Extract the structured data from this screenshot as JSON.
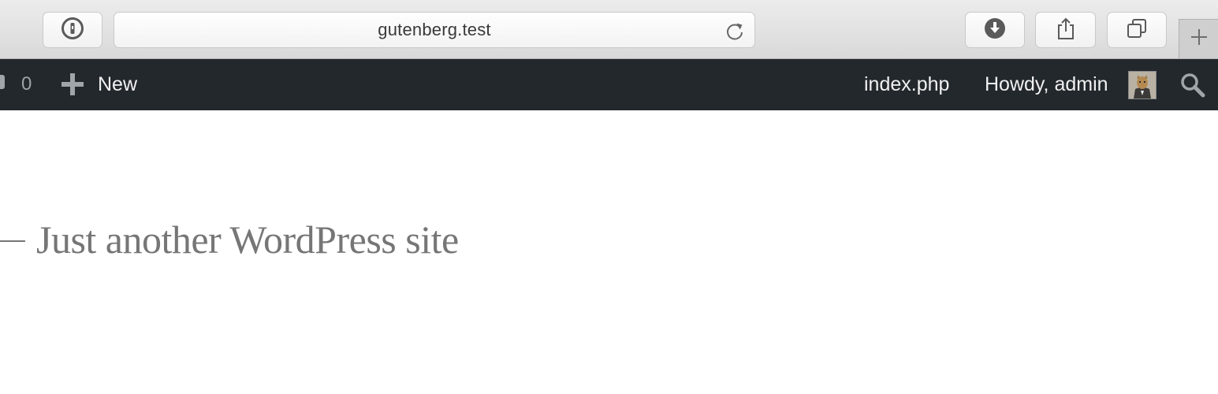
{
  "browser": {
    "address": "gutenberg.test",
    "icons": {
      "password_manager": "1password-icon",
      "reload": "reload-icon",
      "download": "download-icon",
      "share": "share-icon",
      "tabs": "tab-overview-icon",
      "new_tab": "plus-icon"
    }
  },
  "adminbar": {
    "comments_count": "0",
    "new_label": "New",
    "page_link": "index.php",
    "greeting": "Howdy, admin",
    "icons": {
      "new": "plus-icon",
      "search": "search-icon",
      "avatar": "avatar"
    }
  },
  "content": {
    "tagline": "Just another WordPress site"
  },
  "colors": {
    "adminbar_bg": "#23282d",
    "toolbar_bg": "#dcdcdc",
    "tagline_text": "#767676"
  }
}
